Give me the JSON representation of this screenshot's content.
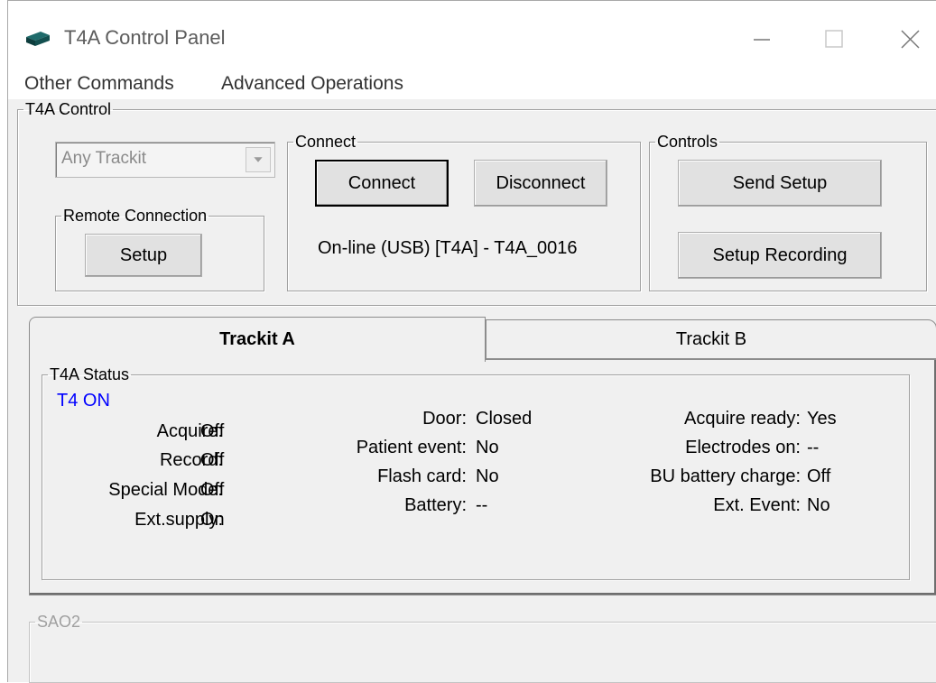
{
  "window": {
    "title": "T4A Control Panel",
    "icon": "device-icon",
    "controls": {
      "minimize": "—",
      "maximize": "☐",
      "close": "✕"
    }
  },
  "menu": {
    "other_commands": "Other Commands",
    "advanced_operations": "Advanced Operations"
  },
  "control_group": {
    "legend": "T4A Control",
    "trackit_select": {
      "value": "Any Trackit"
    },
    "remote": {
      "legend": "Remote Connection",
      "setup_label": "Setup"
    },
    "connect": {
      "legend": "Connect",
      "connect_label": "Connect",
      "disconnect_label": "Disconnect",
      "status_text": "On-line (USB) [T4A] - T4A_0016"
    },
    "controls": {
      "legend": "Controls",
      "send_setup_label": "Send Setup",
      "setup_recording_label": "Setup Recording"
    }
  },
  "tabs": [
    {
      "label": "Trackit A",
      "active": true
    },
    {
      "label": "Trackit B",
      "active": false
    }
  ],
  "status": {
    "legend": "T4A Status",
    "state": "T4 ON",
    "state_color": "#0000ff",
    "col1": [
      {
        "label": "Acquire:",
        "value": "Off"
      },
      {
        "label": "Record:",
        "value": "Off"
      },
      {
        "label": "Special Mode:",
        "value": "Off"
      },
      {
        "label": "Ext.supply:",
        "value": "On"
      }
    ],
    "col2": [
      {
        "label": "Door:",
        "value": "Closed"
      },
      {
        "label": "Patient event:",
        "value": "No"
      },
      {
        "label": "Flash card:",
        "value": "No"
      },
      {
        "label": "Battery:",
        "value": "--"
      }
    ],
    "col3": [
      {
        "label": "Acquire ready:",
        "value": "Yes"
      },
      {
        "label": "Electrodes on:",
        "value": "--"
      },
      {
        "label": "BU battery charge:",
        "value": "Off"
      },
      {
        "label": "Ext. Event:",
        "value": "No"
      }
    ]
  },
  "sao2": {
    "legend": "SAO2"
  }
}
